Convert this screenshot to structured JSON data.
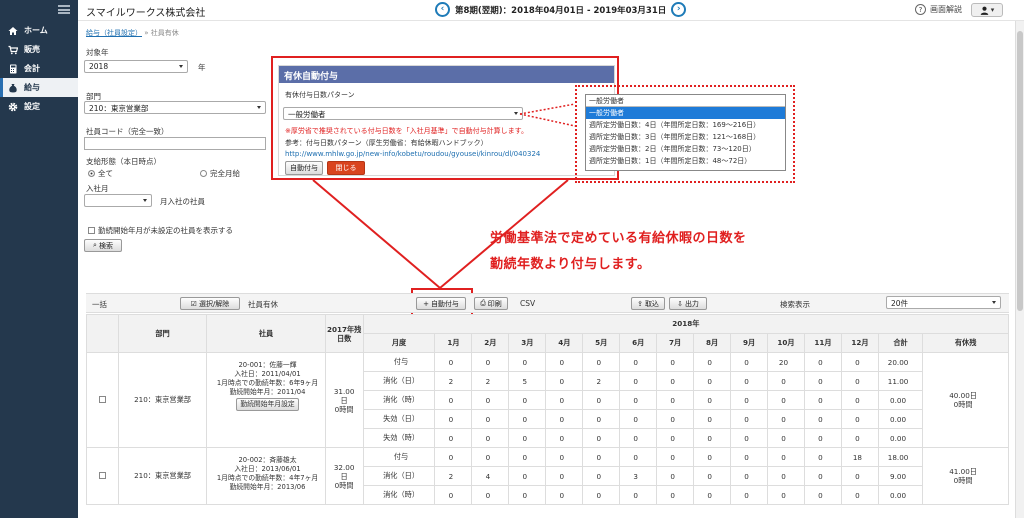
{
  "sidebar": {
    "items": [
      {
        "label": "ホーム",
        "icon": "home-icon"
      },
      {
        "label": "販売",
        "icon": "cart-icon"
      },
      {
        "label": "会計",
        "icon": "calc-icon"
      },
      {
        "label": "給与",
        "icon": "money-bag-icon",
        "active": true
      },
      {
        "label": "設定",
        "icon": "gear-icon"
      }
    ]
  },
  "header": {
    "company": "スマイルワークス株式会社",
    "period": "第8期(翌期)：2018年04月01日 - 2019年03月31日",
    "help": "画面解説"
  },
  "breadcrumb": {
    "link": "給与（社員設定）",
    "current": "社員有休"
  },
  "filters": {
    "year_label": "対象年",
    "year_value": "2018",
    "year_unit": "年",
    "dept_label": "部門",
    "dept_value": "210：東京営業部",
    "code_label": "社員コード（完全一致）",
    "pay_label": "支給形態（本日時点）",
    "pay_all": "全て",
    "pay_monthly": "完全月給",
    "join_label": "入社月",
    "join_suffix": "月入社の社員",
    "checkbox_label": "勤続開始年月が未設定の社員を表示する",
    "search_button": "検索"
  },
  "modal": {
    "title": "有休自動付与",
    "pattern_label": "有休付与日数パターン",
    "pattern_value": "一般労働者",
    "note": "※厚労省で推奨されている付与日数を「入社月基準」で自動付与計算します。",
    "ref": "参考：付与日数パターン（厚生労働省：有給休暇ハンドブック）",
    "url": "http://www.mhlw.go.jp/new-info/kobetu/roudou/gyousei/kinrou/dl/040324",
    "auto_button": "自動付与",
    "close_button": "閉じる"
  },
  "dropdown": {
    "selected": "一般労働者",
    "options": [
      "一般労働者",
      "週所定労働日数：4日（年間所定日数：169〜216日）",
      "週所定労働日数：3日（年間所定日数：121〜168日）",
      "週所定労働日数：2日（年間所定日数：73〜120日）",
      "週所定労働日数：1日（年間所定日数：48〜72日）"
    ]
  },
  "callout": {
    "line1": "労働基準法で定めている有給休暇の日数を",
    "line2": "勤続年数より付与します。"
  },
  "toolbar": {
    "bulk": "一括",
    "select_clear": "選択/解除",
    "employee_leave": "社員有休",
    "auto_grant": "自動付与",
    "print": "印刷",
    "csv": "CSV",
    "import": "取込",
    "export": "出力",
    "search_display": "検索表示",
    "per_page": "20件"
  },
  "table": {
    "headers": {
      "dept": "部門",
      "employee": "社員",
      "carry": "2017年残日数",
      "year": "2018年",
      "type": "月度",
      "total": "合計",
      "remaining": "有休残"
    },
    "months": [
      "1月",
      "2月",
      "3月",
      "4月",
      "5月",
      "6月",
      "7月",
      "8月",
      "9月",
      "10月",
      "11月",
      "12月"
    ],
    "employees": [
      {
        "dept": "210：東京営業部",
        "id_name": "20-001：佐藤一輝",
        "join": "入社日：2011/04/01",
        "tenure": "1月時点での勤続年数：6年9ヶ月",
        "start": "勤続開始年月：2011/04",
        "start_button": "勤続開始年月設定",
        "carry": "31.00",
        "carry_unit": "日",
        "carry_hours": "0時間",
        "remaining": "40.00日",
        "remaining_hours": "0時間",
        "rows": [
          {
            "type": "付与",
            "vals": [
              "0",
              "0",
              "0",
              "0",
              "0",
              "0",
              "0",
              "0",
              "0",
              "20",
              "0",
              "0"
            ],
            "total": "20.00"
          },
          {
            "type": "消化（日）",
            "vals": [
              "2",
              "2",
              "5",
              "0",
              "2",
              "0",
              "0",
              "0",
              "0",
              "0",
              "0",
              "0"
            ],
            "total": "11.00"
          },
          {
            "type": "消化（時）",
            "vals": [
              "0",
              "0",
              "0",
              "0",
              "0",
              "0",
              "0",
              "0",
              "0",
              "0",
              "0",
              "0"
            ],
            "total": "0.00"
          },
          {
            "type": "失効（日）",
            "vals": [
              "0",
              "0",
              "0",
              "0",
              "0",
              "0",
              "0",
              "0",
              "0",
              "0",
              "0",
              "0"
            ],
            "total": "0.00"
          },
          {
            "type": "失効（時）",
            "vals": [
              "0",
              "0",
              "0",
              "0",
              "0",
              "0",
              "0",
              "0",
              "0",
              "0",
              "0",
              "0"
            ],
            "total": "0.00"
          }
        ]
      },
      {
        "dept": "210：東京営業部",
        "id_name": "20-002：斉藤雄太",
        "join": "入社日：2013/06/01",
        "tenure": "1月時点での勤続年数：4年7ヶ月",
        "start": "勤続開始年月：2013/06",
        "carry": "32.00",
        "carry_unit": "日",
        "carry_hours": "0時間",
        "remaining": "41.00日",
        "remaining_hours": "0時間",
        "rows": [
          {
            "type": "付与",
            "vals": [
              "0",
              "0",
              "0",
              "0",
              "0",
              "0",
              "0",
              "0",
              "0",
              "0",
              "0",
              "18"
            ],
            "total": "18.00"
          },
          {
            "type": "消化（日）",
            "vals": [
              "2",
              "4",
              "0",
              "0",
              "0",
              "3",
              "0",
              "0",
              "0",
              "0",
              "0",
              "0"
            ],
            "total": "9.00"
          },
          {
            "type": "消化（時）",
            "vals": [
              "0",
              "0",
              "0",
              "0",
              "0",
              "0",
              "0",
              "0",
              "0",
              "0",
              "0",
              "0"
            ],
            "total": "0.00"
          }
        ]
      }
    ]
  }
}
